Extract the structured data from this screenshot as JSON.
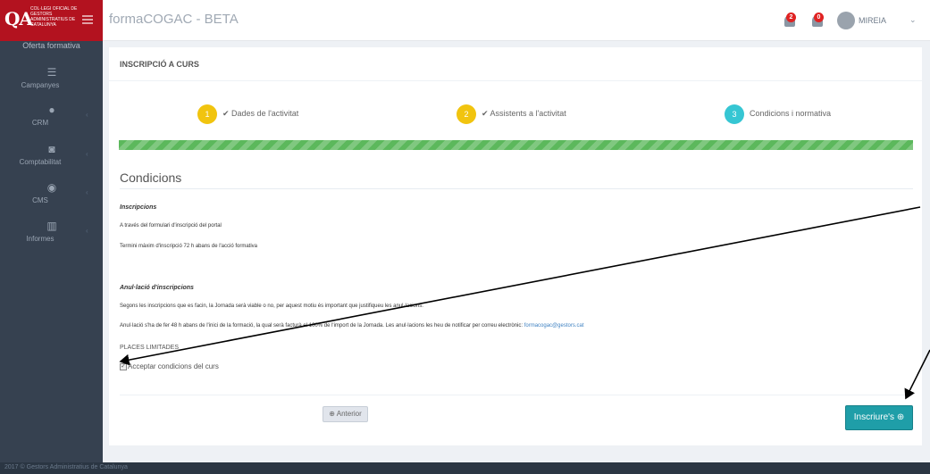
{
  "logo": {
    "mark": "QA",
    "text": "Col·legi Oficial de Gestors Administratius de Catalunya"
  },
  "header": {
    "app_title": "formaCOGAC - BETA",
    "notifications": [
      {
        "icon": "bell-icon",
        "count": "2"
      },
      {
        "icon": "inbox-icon",
        "count": "0"
      }
    ],
    "user_name": "MIREIA",
    "user_caret": "⌄"
  },
  "sidebar": {
    "top_item": "Oferta formativa",
    "items": [
      {
        "icon": "rss-icon",
        "glyph": "☰",
        "label": "Campanyes"
      },
      {
        "icon": "users-icon",
        "glyph": "●",
        "label": "CRM"
      },
      {
        "icon": "money-icon",
        "glyph": "◙",
        "label": "Comptabilitat"
      },
      {
        "icon": "globe-icon",
        "glyph": "◉",
        "label": "CMS"
      },
      {
        "icon": "bar-chart-icon",
        "glyph": "▥",
        "label": "Informes"
      }
    ]
  },
  "page": {
    "title": "INSCRIPCIÓ A CURS",
    "steps": [
      {
        "number": "1",
        "label": "✔ Dades de l'activitat",
        "color": "#f1c40f"
      },
      {
        "number": "2",
        "label": "✔ Assistents a l'activitat",
        "color": "#f1c40f"
      },
      {
        "number": "3",
        "label": "Condicions i normativa",
        "color": "#36c6d3"
      }
    ],
    "progress_percent": 100,
    "section_title": "Condicions",
    "inscripcions_heading": "Inscripcions",
    "inscripcions_line1": "A través del formulari d'inscripció del portal",
    "inscripcions_line2": "Termini màxim d'inscripció 72 h abans de l'acció formativa",
    "anulacio_heading": "Anul·lació d'inscripcions",
    "anulacio_line1": "Segons les inscripcions que es facin, la Jornada serà viable o no, per aquest motiu és important que justifiqueu les anul·lacions.",
    "anulacio_line2_prefix": "Anul·lació s'ha de fer  48 h abans de l'inici de la formació, la qual serà facturà el 100% de l'import de la Jornada. Les anul·lacions les heu de notificar per correu electrònic:",
    "anulacio_email": "formacogac@gestors.cat",
    "places": "PLACES LIMITADES",
    "accept_label": "Acceptar condicions del curs",
    "accept_checked": true,
    "prev_button": "⊕ Anterior",
    "submit_button": "Inscriure's ⊕"
  },
  "footer": {
    "text": "2017 © Gestors Administratius de Catalunya"
  }
}
